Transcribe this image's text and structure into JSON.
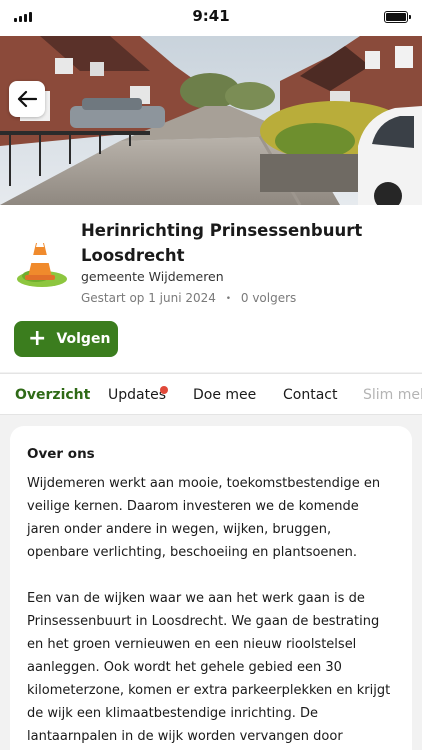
{
  "status_bar": {
    "time": "9:41"
  },
  "project": {
    "title": "Herinrichting Prinsessenbuurt Loosdrecht",
    "organization": "gemeente Wijdemeren",
    "started": "Gestart op 1 juni 2024",
    "separator": "•",
    "followers": "0 volgers"
  },
  "follow_button": {
    "icon": "plus-icon",
    "label": "Volgen"
  },
  "tabs": [
    {
      "label": "Overzicht",
      "active": true
    },
    {
      "label": "Updates",
      "badge": true
    },
    {
      "label": "Doe mee"
    },
    {
      "label": "Contact"
    },
    {
      "label": "Slim melden"
    }
  ],
  "about": {
    "heading": "Over ons",
    "paragraphs": [
      "Wijdemeren werkt aan mooie, toekomstbestendige en veilige kernen. Daarom investeren we de komende jaren onder andere in wegen, wijken, bruggen, openbare verlichting, beschoeiing en plantsoenen.",
      "Een van de wijken waar we aan het werk gaan is de Prinsessenbuurt in Loosdrecht.  We gaan de bestrating en het groen vernieuwen en een nieuw rioolstelsel aanleggen. Ook wordt het gehele gebied een 30 kilometerzone, komen er extra parkeerplekken en krijgt de wijk een klimaatbestendige inrichting. De lantaarnpalen in de wijk worden vervangen door"
    ]
  },
  "colors": {
    "accent": "#3b7d1e",
    "active_tab": "#2f6a17",
    "badge": "#e0493a"
  },
  "icons": {
    "back": "arrow-left-icon",
    "logo": "traffic-cone-icon"
  }
}
